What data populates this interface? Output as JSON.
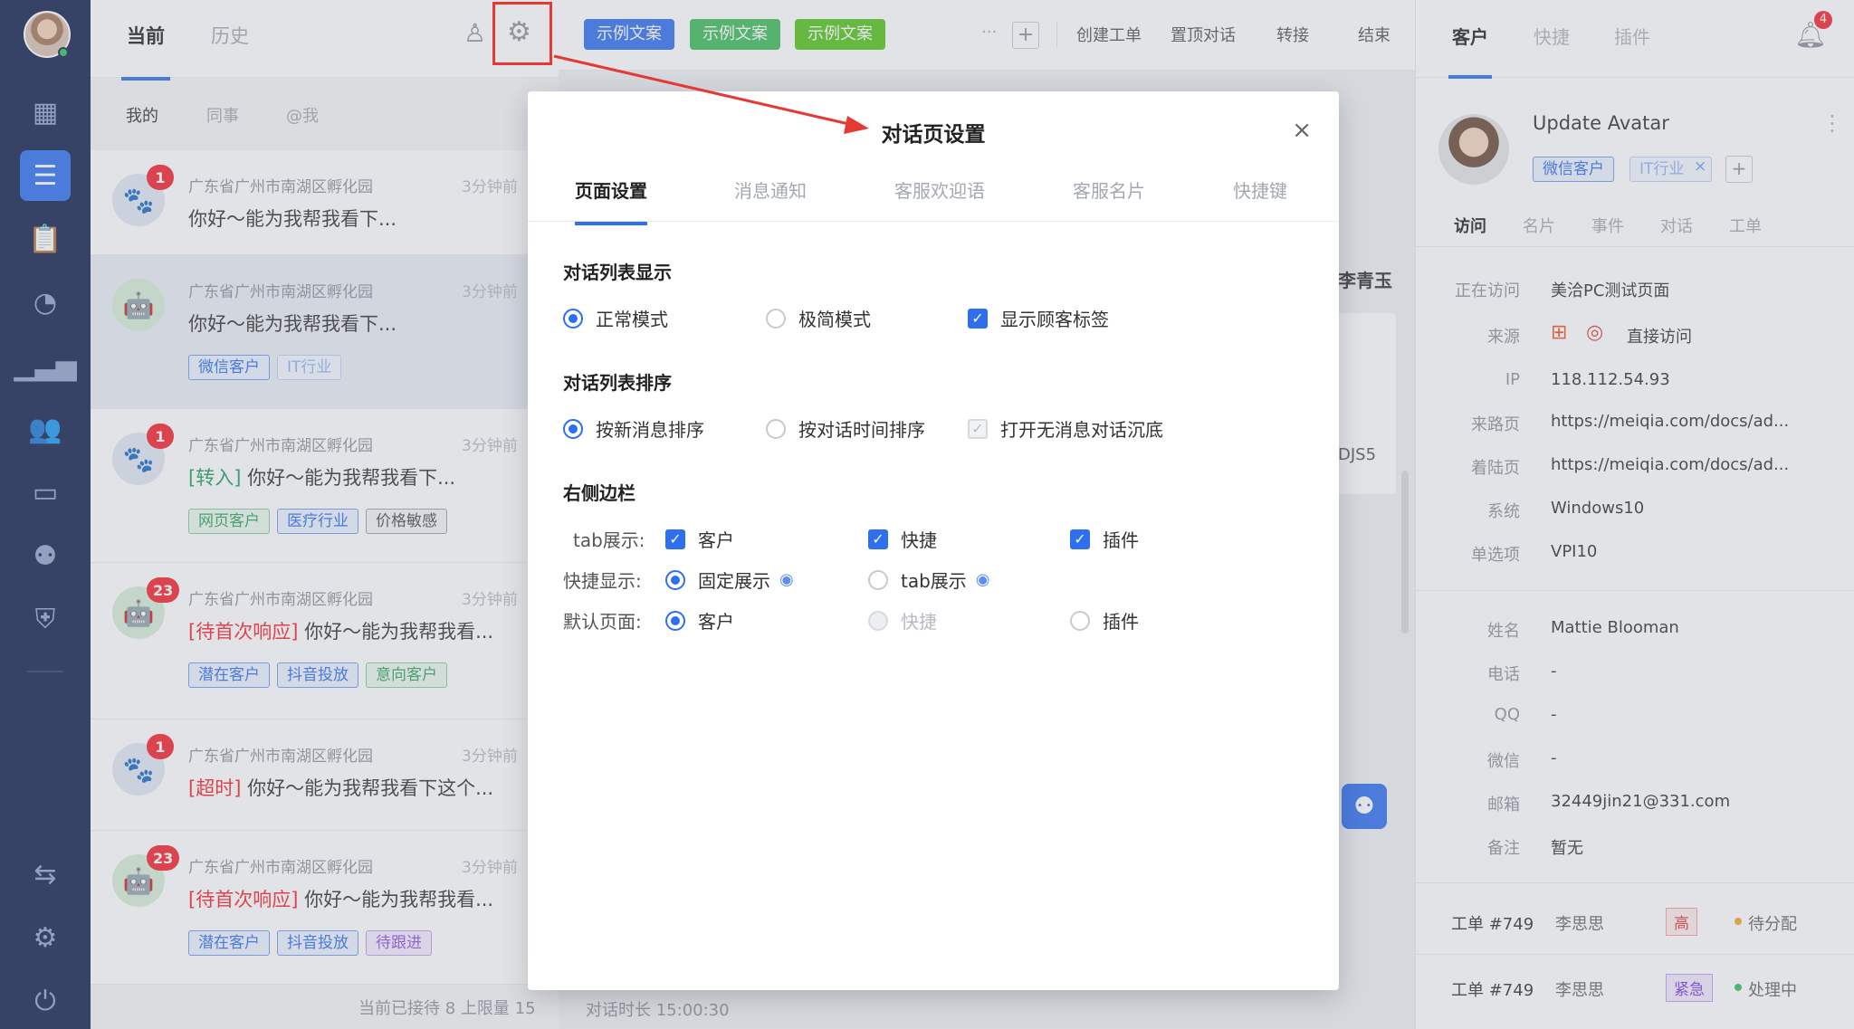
{
  "nav": {
    "icons": [
      "dashboard-icon",
      "chat-icon",
      "clipboard-icon",
      "clock-icon",
      "bar-chart-icon",
      "users-icon",
      "monitor-icon",
      "robot-icon",
      "shield-icon",
      "transfer-icon",
      "gear-icon",
      "logout-icon"
    ],
    "active": "chat-icon"
  },
  "convlist": {
    "tabs": [
      "当前",
      "历史"
    ],
    "filters": [
      "我的",
      "同事",
      "@我"
    ],
    "footer": "当前已接待 8 上限量 15",
    "items": [
      {
        "avatar": "paw",
        "badge": "1",
        "location": "广东省广州市南湖区孵化园",
        "time": "3分钟前",
        "prefix": "",
        "prefix_color": "",
        "message": "你好～能为我帮我看下...",
        "tags": []
      },
      {
        "avatar": "android",
        "badge": "",
        "location": "广东省广州市南湖区孵化园",
        "time": "3分钟前",
        "prefix": "",
        "prefix_color": "",
        "message": "你好～能为我帮我看下...",
        "tags": [
          {
            "text": "微信客户",
            "style": "blue"
          },
          {
            "text": "IT行业",
            "style": "lblue"
          }
        ]
      },
      {
        "avatar": "paw",
        "badge": "1",
        "location": "广东省广州市南湖区孵化园",
        "time": "3分钟前",
        "prefix": "[转入]",
        "prefix_color": "g",
        "message": " 你好～能为我帮我看下...",
        "tags": [
          {
            "text": "网页客户",
            "style": "green"
          },
          {
            "text": "医疗行业",
            "style": "blue"
          },
          {
            "text": "价格敏感",
            "style": "gray"
          }
        ]
      },
      {
        "avatar": "android",
        "badge": "23",
        "location": "广东省广州市南湖区孵化园",
        "time": "3分钟前",
        "prefix": "[待首次响应]",
        "prefix_color": "",
        "message": " 你好～能为我帮我看...",
        "tags": [
          {
            "text": "潜在客户",
            "style": "blue"
          },
          {
            "text": "抖音投放",
            "style": "blue"
          },
          {
            "text": "意向客户",
            "style": "green"
          }
        ]
      },
      {
        "avatar": "paw",
        "badge": "1",
        "location": "广东省广州市南湖区孵化园",
        "time": "3分钟前",
        "prefix": "[超时]",
        "prefix_color": "",
        "message": " 你好～能为我帮我看下这个...",
        "tags": []
      },
      {
        "avatar": "android",
        "badge": "23",
        "location": "广东省广州市南湖区孵化园",
        "time": "3分钟前",
        "prefix": "[待首次响应]",
        "prefix_color": "",
        "message": " 你好～能为我帮我看...",
        "tags": [
          {
            "text": "潜在客户",
            "style": "blue"
          },
          {
            "text": "抖音投放",
            "style": "blue"
          },
          {
            "text": "待跟进",
            "style": "purple"
          }
        ]
      }
    ]
  },
  "toolbar": {
    "sample_buttons": [
      {
        "label": "示例文案",
        "color": "#2e6ff0"
      },
      {
        "label": "示例文案",
        "color": "#3cbc5b"
      },
      {
        "label": "示例文案",
        "color": "#52c41a"
      }
    ],
    "more": "···",
    "add": "+",
    "actions": [
      "创建工单",
      "置顶对话",
      "转接",
      "结束"
    ]
  },
  "middle": {
    "visitor_name": "李青玉",
    "snippet": "DJS5",
    "duration": "对话时长 15:00:30"
  },
  "right": {
    "tabs": [
      "客户",
      "快捷",
      "插件"
    ],
    "notify_count": "4",
    "name": "Update Avatar",
    "tags": [
      "微信客户",
      "IT行业"
    ],
    "tag_close": "×",
    "tag_add": "+",
    "subtabs": [
      "访问",
      "名片",
      "事件",
      "对话",
      "工单"
    ],
    "visit": [
      {
        "label": "正在访问",
        "value": "美洽PC测试页面"
      },
      {
        "label": "来源",
        "value": "直接访问"
      },
      {
        "label": "IP",
        "value": "118.112.54.93"
      },
      {
        "label": "来路页",
        "value": "https://meiqia.com/docs/ad..."
      },
      {
        "label": "着陆页",
        "value": "https://meiqia.com/docs/ad..."
      },
      {
        "label": "系统",
        "value": "Windows10"
      },
      {
        "label": "单选项",
        "value": "VPI10"
      }
    ],
    "profile": [
      {
        "label": "姓名",
        "value": "Mattie Blooman"
      },
      {
        "label": "电话",
        "value": "-"
      },
      {
        "label": "QQ",
        "value": "-"
      },
      {
        "label": "微信",
        "value": "-"
      },
      {
        "label": "邮箱",
        "value": "32449jin21@331.com"
      },
      {
        "label": "备注",
        "value": "暂无"
      }
    ],
    "tickets": [
      {
        "id": "工单 #749",
        "owner": "李思思",
        "priority": "高",
        "status": "待分配",
        "status_color": "#f5a623"
      },
      {
        "id": "工单 #749",
        "owner": "李思思",
        "priority": "紧急",
        "status": "处理中",
        "status_color": "#2fc25b"
      }
    ]
  },
  "dialog": {
    "title": "对话页设置",
    "close": "×",
    "tabs": [
      "页面设置",
      "消息通知",
      "客服欢迎语",
      "客服名片",
      "快捷键"
    ],
    "sec1": {
      "title": "对话列表显示",
      "opt1": "正常模式",
      "opt2": "极简模式",
      "opt3": "显示顾客标签"
    },
    "sec2": {
      "title": "对话列表排序",
      "opt1": "按新消息排序",
      "opt2": "按对话时间排序",
      "opt3": "打开无消息对话沉底"
    },
    "sec3": {
      "title": "右侧边栏",
      "tab_label": "tab展示:",
      "tab_opts": [
        "客户",
        "快捷",
        "插件"
      ],
      "quick_label": "快捷显示:",
      "quick_opts": [
        "固定展示",
        "tab展示"
      ],
      "default_label": "默认页面:",
      "default_opts": [
        "客户",
        "快捷",
        "插件"
      ]
    }
  },
  "annotation": {
    "color": "#e53935"
  }
}
